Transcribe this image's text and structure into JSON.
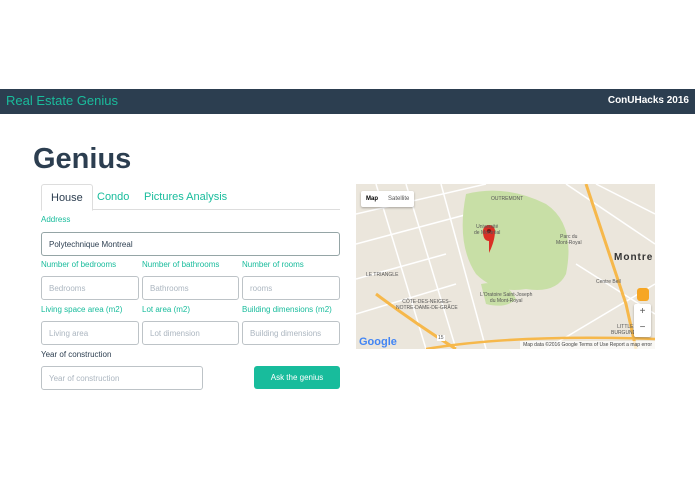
{
  "navbar": {
    "brand": "Real Estate Genius",
    "right_text": "ConUHacks 2016"
  },
  "page_title": "Genius",
  "tabs": [
    {
      "label": "House",
      "active": true
    },
    {
      "label": "Condo",
      "active": false
    },
    {
      "label": "Pictures Analysis",
      "active": false
    }
  ],
  "form": {
    "address_label": "Address",
    "address_value": "Polytechnique Montreal",
    "bedrooms_label": "Number of bedrooms",
    "bedrooms_placeholder": "Bedrooms",
    "bathrooms_label": "Number of bathrooms",
    "bathrooms_placeholder": "Bathrooms",
    "rooms_label": "Number of rooms",
    "rooms_placeholder": "rooms",
    "living_label": "Living space area (m2)",
    "living_placeholder": "Living area",
    "lot_label": "Lot area (m2)",
    "lot_placeholder": "Lot dimension",
    "building_label": "Building dimensions (m2)",
    "building_placeholder": "Building dimensions",
    "year_label": "Year of construction",
    "year_placeholder": "Year of construction",
    "submit_label": "Ask the genius"
  },
  "map": {
    "map_button": "Map",
    "satellite_button": "Satellite",
    "zoom_in": "+",
    "zoom_out": "−",
    "google_logo": "Google",
    "attribution": "Map data ©2016 Google   Terms of Use   Report a map error",
    "labels": {
      "universite": "Université\nde Montréal",
      "parc": "Parc du\nMont-Royal",
      "oratoire": "L'Oratoire Saint-Joseph\ndu Mont-Royal",
      "cote": "CÔTE-DES-NEIGES–\nNOTRE-DAME-DE-GRÂCE",
      "outremont": "OUTREMONT",
      "montreal": "Montre",
      "centre_bell": "Centre Bell",
      "triangle": "LE TRIANGLE",
      "little": "LITTLE\nBURGUNDY",
      "highway": "15"
    },
    "colors": {
      "park": "#c8dfa6",
      "highway": "#f6b84b",
      "marker": "#d93025"
    }
  },
  "colors": {
    "primary": "#2c3e50",
    "accent": "#18bc9c"
  }
}
